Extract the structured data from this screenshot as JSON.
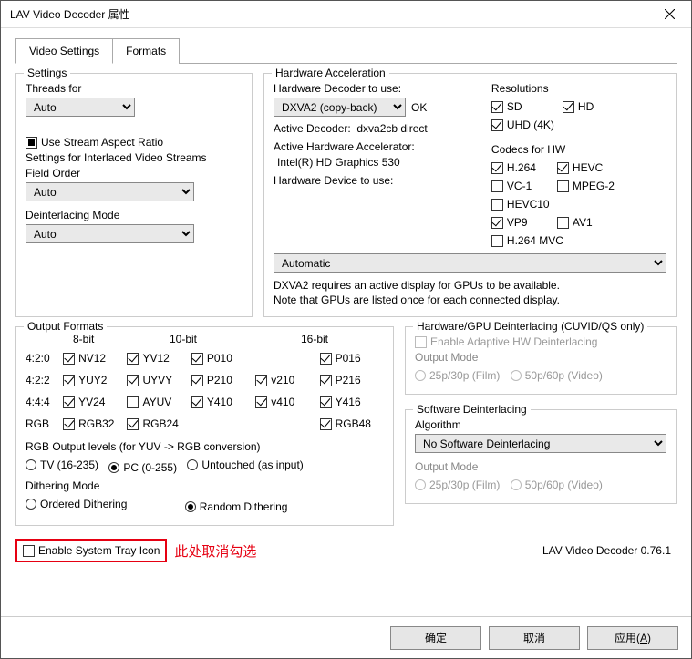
{
  "window": {
    "title": "LAV Video Decoder 属性"
  },
  "tabs": [
    {
      "label": "Video Settings",
      "active": true
    },
    {
      "label": "Formats",
      "active": false
    }
  ],
  "settings": {
    "legend": "Settings",
    "threads_label": "Threads for",
    "threads_value": "Auto",
    "stream_aspect_label": "Use Stream Aspect Ratio",
    "interlaced_header": "Settings for Interlaced Video Streams",
    "field_order_label": "Field Order",
    "field_order_value": "Auto",
    "deint_mode_label": "Deinterlacing Mode",
    "deint_mode_value": "Auto"
  },
  "hw": {
    "legend": "Hardware Acceleration",
    "decoder_label": "Hardware Decoder to use:",
    "decoder_value": "DXVA2 (copy-back)",
    "decoder_ok": "OK",
    "active_decoder_label": "Active Decoder:",
    "active_decoder_value": "dxva2cb direct",
    "active_accel_label": "Active Hardware Accelerator:",
    "active_accel_value": "Intel(R) HD Graphics 530",
    "device_label": "Hardware Device to use:",
    "device_value": "Automatic",
    "note1": "DXVA2 requires an active display for GPUs to be available.",
    "note2": "Note that GPUs are listed once for each connected display.",
    "res_label": "Resolutions",
    "res": [
      {
        "label": "SD",
        "checked": true
      },
      {
        "label": "HD",
        "checked": true
      },
      {
        "label": "UHD (4K)",
        "checked": true
      }
    ],
    "codecs_label": "Codecs for HW",
    "codecs": [
      {
        "label": "H.264",
        "checked": true
      },
      {
        "label": "HEVC",
        "checked": true
      },
      {
        "label": "VC-1",
        "checked": false
      },
      {
        "label": "MPEG-2",
        "checked": false
      },
      {
        "label": "HEVC10",
        "checked": false
      },
      {
        "label": "",
        "checked": false,
        "blank": true
      },
      {
        "label": "VP9",
        "checked": true
      },
      {
        "label": "AV1",
        "checked": false
      },
      {
        "label": "H.264 MVC",
        "checked": false
      }
    ]
  },
  "output": {
    "legend": "Output Formats",
    "bits": {
      "b8": "8-bit",
      "b10": "10-bit",
      "b16": "16-bit"
    },
    "rows": [
      {
        "label": "4:2:0",
        "cells": [
          {
            "label": "NV12",
            "checked": true
          },
          {
            "label": "YV12",
            "checked": true
          },
          {
            "label": "P010",
            "checked": true
          },
          {
            "blank": true
          },
          {
            "label": "P016",
            "checked": true
          }
        ]
      },
      {
        "label": "4:2:2",
        "cells": [
          {
            "label": "YUY2",
            "checked": true
          },
          {
            "label": "UYVY",
            "checked": true
          },
          {
            "label": "P210",
            "checked": true
          },
          {
            "label": "v210",
            "checked": true
          },
          {
            "label": "P216",
            "checked": true
          }
        ]
      },
      {
        "label": "4:4:4",
        "cells": [
          {
            "label": "YV24",
            "checked": true
          },
          {
            "label": "AYUV",
            "checked": false
          },
          {
            "label": "Y410",
            "checked": true
          },
          {
            "label": "v410",
            "checked": true
          },
          {
            "label": "Y416",
            "checked": true
          }
        ]
      },
      {
        "label": "RGB",
        "cells": [
          {
            "label": "RGB32",
            "checked": true
          },
          {
            "label": "RGB24",
            "checked": true
          },
          {
            "blank": true
          },
          {
            "blank": true
          },
          {
            "label": "RGB48",
            "checked": true
          }
        ]
      }
    ],
    "rgb_levels_label": "RGB Output levels (for YUV -> RGB conversion)",
    "rgb_levels": [
      {
        "label": "TV (16-235)",
        "selected": false
      },
      {
        "label": "PC (0-255)",
        "selected": true
      },
      {
        "label": "Untouched (as input)",
        "selected": false
      }
    ],
    "dither_label": "Dithering Mode",
    "dither": [
      {
        "label": "Ordered Dithering",
        "selected": false
      },
      {
        "label": "Random Dithering",
        "selected": true
      }
    ]
  },
  "hw_deint": {
    "legend": "Hardware/GPU Deinterlacing (CUVID/QS only)",
    "adaptive_label": "Enable Adaptive HW Deinterlacing",
    "output_mode_label": "Output Mode",
    "modes": [
      {
        "label": "25p/30p (Film)"
      },
      {
        "label": "50p/60p (Video)"
      }
    ]
  },
  "sw_deint": {
    "legend": "Software Deinterlacing",
    "algo_label": "Algorithm",
    "algo_value": "No Software Deinterlacing",
    "output_mode_label": "Output Mode",
    "modes": [
      {
        "label": "25p/30p (Film)"
      },
      {
        "label": "50p/60p (Video)"
      }
    ]
  },
  "tray": {
    "label": "Enable System Tray Icon",
    "note": "此处取消勾选"
  },
  "version": "LAV Video Decoder 0.76.1",
  "buttons": {
    "ok": "确定",
    "cancel": "取消",
    "apply_text": "应用(",
    "apply_u": "A",
    "apply_after": ")"
  }
}
